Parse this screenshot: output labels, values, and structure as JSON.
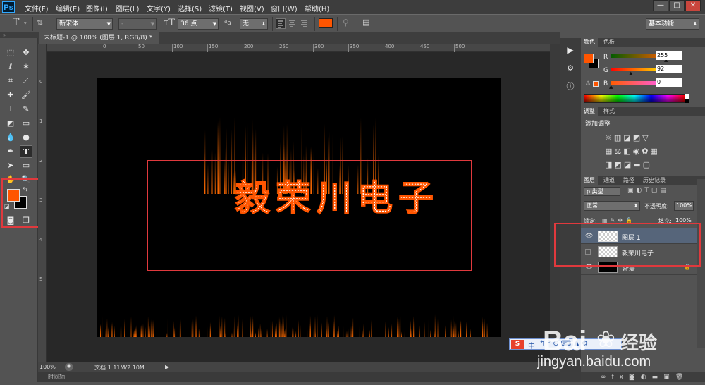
{
  "app": {
    "logo_text": "Ps"
  },
  "menubar": {
    "items": [
      "文件(F)",
      "编辑(E)",
      "图像(I)",
      "图层(L)",
      "文字(Y)",
      "选择(S)",
      "滤镜(T)",
      "视图(V)",
      "窗口(W)",
      "帮助(H)"
    ],
    "window_controls": [
      "—",
      "□",
      "✕"
    ]
  },
  "options_bar": {
    "tool_icon": "T",
    "font_family": "新宋体",
    "font_style": "-",
    "font_size": "36 点",
    "aa_label": "ªa",
    "antialias": "无",
    "text_color": "#ff5500",
    "workspace": "基本功能"
  },
  "document": {
    "tab_title": "未标题-1 @ 100% (图层 1, RGB/8) *",
    "tab_close": "×",
    "text_content": "毅荣川电子",
    "ruler_top_labels": [
      "0",
      "50",
      "100",
      "150",
      "200",
      "250",
      "300",
      "350",
      "400",
      "450",
      "500"
    ],
    "ruler_left_labels": [
      "0",
      "1",
      "2",
      "3",
      "4",
      "5"
    ]
  },
  "toolbox": {
    "foreground_color": "#ff5500",
    "background_color": "#000000"
  },
  "statusbar": {
    "zoom": "100%",
    "doc_info": "文档:1.11M/2.10M"
  },
  "timeline": {
    "label": "时间轴"
  },
  "color_panel": {
    "tabs": [
      "颜色",
      "色板"
    ],
    "channels": [
      {
        "name": "R",
        "value": "255",
        "level": 1.0
      },
      {
        "name": "G",
        "value": "92",
        "level": 0.36
      },
      {
        "name": "B",
        "value": "0",
        "level": 0.0
      }
    ],
    "warning_glyph": "⚠"
  },
  "adjustments_panel": {
    "tabs": [
      "调整",
      "样式"
    ],
    "title": "添加调整"
  },
  "layers_panel": {
    "tabs": [
      "图层",
      "通道",
      "路径",
      "历史记录"
    ],
    "filter_type": "ρ 类型",
    "blend_mode": "正常",
    "opacity_label": "不透明度:",
    "opacity_value": "100%",
    "lock_label": "锁定:",
    "fill_label": "填充:",
    "fill_value": "100%",
    "layers": [
      {
        "name": "图层 1",
        "selected": true,
        "visible": true
      },
      {
        "name": "毅荣川电子",
        "selected": false,
        "visible": false
      },
      {
        "name": "背景",
        "selected": false,
        "visible": true
      }
    ],
    "bottom_icons": [
      "link-icon",
      "fx-icon",
      "mask-icon",
      "adjustment-icon",
      "folder-icon",
      "new-layer-icon",
      "trash-icon"
    ]
  },
  "watermark": {
    "brand": "Bai",
    "brand_cn": "经验",
    "url": "jingyan.baidu.com",
    "ime_text": "中"
  },
  "colors": {
    "accent": "#ff5500",
    "highlight_box": "#e0393d"
  }
}
